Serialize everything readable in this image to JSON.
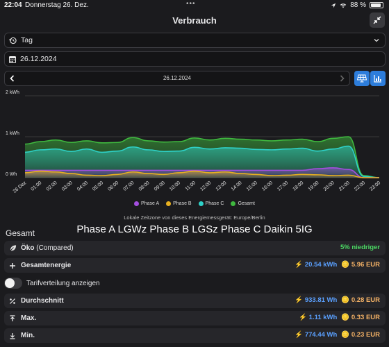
{
  "status": {
    "time": "22:04",
    "date": "Donnerstag 26. Dez.",
    "dots": "•••",
    "battery": "88 %",
    "battery_level": 0.88
  },
  "header": {
    "title": "Verbrauch"
  },
  "period_select": {
    "value": "Tag"
  },
  "date_field": {
    "value": "26.12.2024"
  },
  "date_nav": {
    "label": "26.12.2024"
  },
  "chart_data": {
    "type": "area",
    "ylabels": [
      "2 kWh",
      "1 kWh",
      "0 Wh"
    ],
    "ylim": [
      0,
      2
    ],
    "x": [
      "26 Dez",
      "01:00",
      "02:00",
      "03:00",
      "04:00",
      "05:00",
      "06:00",
      "07:00",
      "08:00",
      "09:00",
      "10:00",
      "11:00",
      "12:00",
      "13:00",
      "14:00",
      "15:00",
      "16:00",
      "17:00",
      "18:00",
      "19:00",
      "20:00",
      "21:00",
      "22:00",
      "23:00"
    ],
    "series": [
      {
        "name": "Gesamt",
        "color": "#3fb83f",
        "values": [
          0.82,
          0.88,
          0.92,
          0.86,
          0.9,
          0.85,
          0.86,
          0.98,
          0.9,
          0.87,
          0.88,
          0.97,
          0.92,
          0.96,
          0.94,
          0.92,
          0.9,
          0.92,
          0.94,
          0.88,
          0.96,
          1.0,
          0.05,
          0.0
        ]
      },
      {
        "name": "Phase C",
        "color": "#2ed1c8",
        "values": [
          0.62,
          0.68,
          0.7,
          0.64,
          0.7,
          0.62,
          0.65,
          0.75,
          0.68,
          0.64,
          0.65,
          0.74,
          0.7,
          0.73,
          0.72,
          0.69,
          0.68,
          0.7,
          0.72,
          0.65,
          0.7,
          0.77,
          0.03,
          0.0
        ]
      },
      {
        "name": "Phase A",
        "color": "#a44ee0",
        "values": [
          0.18,
          0.18,
          0.18,
          0.18,
          0.18,
          0.18,
          0.18,
          0.18,
          0.18,
          0.18,
          0.18,
          0.18,
          0.18,
          0.18,
          0.18,
          0.18,
          0.18,
          0.18,
          0.18,
          0.22,
          0.24,
          0.2,
          0.0,
          0.0
        ]
      },
      {
        "name": "Phase B",
        "color": "#e8b020",
        "values": [
          0.12,
          0.16,
          0.14,
          0.1,
          0.06,
          0.05,
          0.08,
          0.14,
          0.1,
          0.08,
          0.12,
          0.16,
          0.12,
          0.14,
          0.1,
          0.08,
          0.05,
          0.06,
          0.08,
          0.07,
          0.05,
          0.06,
          0.0,
          0.0
        ]
      }
    ]
  },
  "legend": [
    "Phase A",
    "Phase B",
    "Phase C",
    "Gesamt"
  ],
  "tz_note": "Lokale Zeitzone von dieses Energiemessgerät: Europe/Berlin",
  "overlay_caption": "Phase A LGWz Phase B LGSz Phase C Daikin 5IG",
  "section_title": "Gesamt",
  "rows": {
    "oeko": {
      "label": "Öko",
      "suffix": "(Compared)",
      "value": "5% niedriger"
    },
    "gesamtenergie": {
      "label": "Gesamtenergie",
      "energy": "20.54 kWh",
      "cost": "5.96 EUR"
    },
    "durchschnitt": {
      "label": "Durchschnitt",
      "energy": "933.81 Wh",
      "cost": "0.28 EUR"
    },
    "max": {
      "label": "Max.",
      "energy": "1.11 kWh",
      "cost": "0.33 EUR"
    },
    "min": {
      "label": "Min.",
      "energy": "774.44 Wh",
      "cost": "0.23 EUR"
    }
  },
  "toggle": {
    "label": "Tarifverteilung anzeigen",
    "on": false
  }
}
